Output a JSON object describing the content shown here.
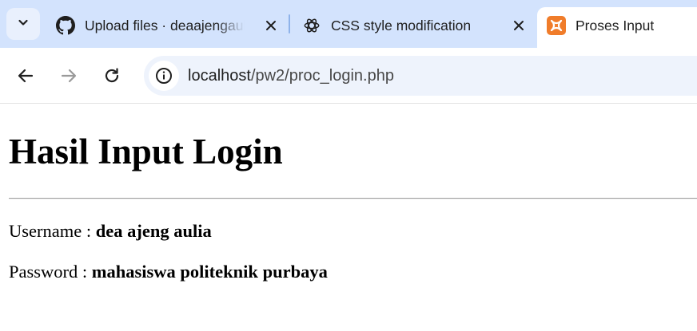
{
  "browser": {
    "tabs": [
      {
        "title": "Upload files · deaajengaulia",
        "favicon": "github-icon"
      },
      {
        "title": "CSS style modification",
        "favicon": "chatgpt-icon"
      },
      {
        "title": "Proses Input",
        "favicon": "xampp-icon"
      }
    ],
    "address": {
      "host": "localhost",
      "path": "/pw2/proc_login.php"
    }
  },
  "page": {
    "heading": "Hasil Input Login",
    "username_label": "Username : ",
    "username_value": "dea ajeng aulia",
    "password_label": "Password : ",
    "password_value": "mahasiswa politeknik purbaya"
  },
  "colors": {
    "tabstrip": "#d3e3fd",
    "omnibox": "#eef3fc",
    "xampp_orange": "#f07c2a"
  }
}
